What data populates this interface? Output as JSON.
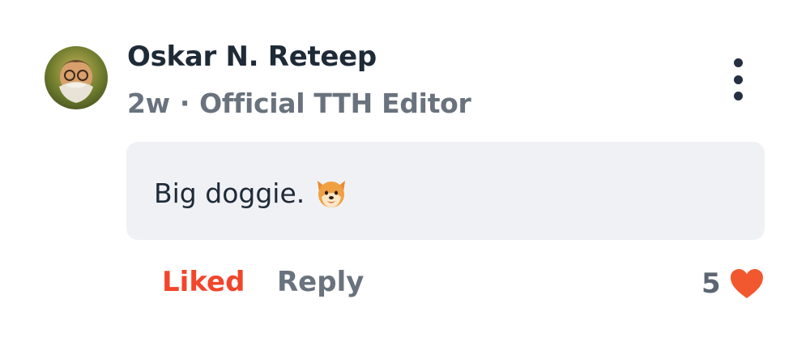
{
  "comment": {
    "author": "Oskar N. Reteep",
    "time_ago": "2w",
    "separator": "·",
    "role": "Official TTH Editor",
    "body": "Big doggie.",
    "body_emoji": "dog-face-emoji",
    "avatar_icon": "user-avatar",
    "more_icon": "vertical-ellipsis-icon"
  },
  "actions": {
    "liked_label": "Liked",
    "reply_label": "Reply",
    "like_count": "5",
    "heart_icon": "heart-icon"
  },
  "colors": {
    "liked": "#f2452b",
    "heart": "#f2582f",
    "author": "#1f2a37",
    "meta": "#69727d",
    "bubble": "#f0f1f5"
  }
}
